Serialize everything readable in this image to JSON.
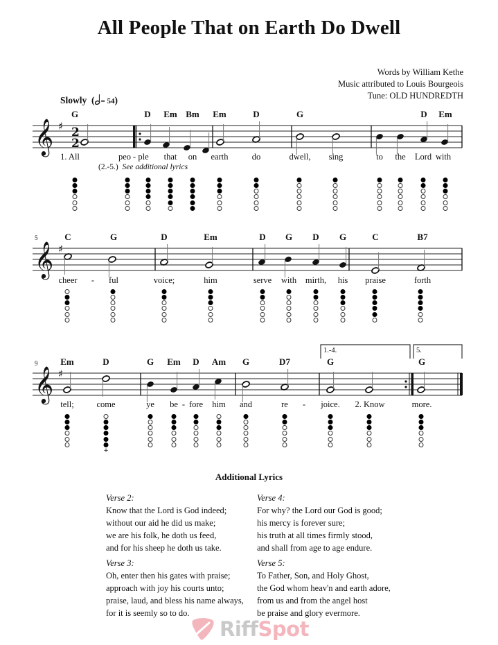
{
  "title": "All People That on Earth Do Dwell",
  "credits": [
    "Words by William Kethe",
    "Music attributed to Louis Bourgeois",
    "Tune: OLD HUNDREDTH"
  ],
  "tempo": {
    "label": "Slowly",
    "bpm_text": "= 54",
    "note": "half"
  },
  "key_signature": "G major (1 sharp)",
  "time_signature": "2/2",
  "systems": [
    {
      "measure_number": "",
      "chords": [
        "G",
        "D",
        "Em",
        "Bm",
        "Em",
        "D",
        "G",
        "D",
        "Em"
      ],
      "lyrics": [
        "1. All",
        "peo",
        "-",
        "ple",
        "that",
        "on",
        "earth",
        "do",
        "dwell,",
        "sing",
        "to",
        "the",
        "Lord",
        "with"
      ],
      "alt_lyric": {
        "prefix": "(2.-5.)",
        "text": "See additional lyrics"
      },
      "fingerings": [
        "CCCOOO",
        "CCCOOO",
        "CCCCOO",
        "CCCCCO",
        "CCCCCC",
        "CCCOOO",
        "CCOOOO",
        "COOOOO",
        "COOOOO",
        "COOOOO",
        "COOOOO",
        "CCOOOO",
        "CCCOOO"
      ]
    },
    {
      "measure_number": "5",
      "chords": [
        "C",
        "G",
        "D",
        "Em",
        "D",
        "G",
        "D",
        "G",
        "C",
        "B7"
      ],
      "lyrics": [
        "cheer",
        "-",
        "ful",
        "voice;",
        "him",
        "serve",
        "with",
        "mirth,",
        "his",
        "praise",
        "forth"
      ],
      "fingerings": [
        "OCCOOO",
        "COOOOO",
        "CCOOOO",
        "CCCOOO",
        "CCOOOO",
        "COOOOO",
        "CCOOOO",
        "CCCOOO",
        "CCCCCO",
        "CCCCOO"
      ]
    },
    {
      "measure_number": "9",
      "chords": [
        "Em",
        "D",
        "G",
        "Em",
        "D",
        "Am",
        "G",
        "D7",
        "G",
        "G"
      ],
      "endings": [
        "1.-4.",
        "5."
      ],
      "lyrics": [
        "tell;",
        "come",
        "ye",
        "be",
        "-",
        "fore",
        "him",
        "and",
        "re",
        "-",
        "joice.",
        "2. Know",
        "more."
      ],
      "fingerings": [
        "CCCOOO",
        "OCCCCC+",
        "COOOOO",
        "CCCOOO",
        "CCOOOO",
        "OCCOOO",
        "COOOOO",
        "CCOOOO",
        "CCCOOO",
        "CCCOOO",
        "CCCOOO"
      ]
    }
  ],
  "additional_lyrics": {
    "title": "Additional Lyrics",
    "verses": [
      {
        "label": "Verse 2:",
        "lines": [
          "Know that the Lord is God indeed;",
          "without our aid he did us make;",
          "we are his folk, he doth us feed,",
          "and for his sheep he doth us take."
        ]
      },
      {
        "label": "Verse 4:",
        "lines": [
          "For why? the Lord our God is good;",
          "his mercy is forever sure;",
          "his truth at all times firmly stood,",
          "and shall from age to age endure."
        ]
      },
      {
        "label": "Verse 3:",
        "lines": [
          "Oh, enter then his gates with praise;",
          "approach with joy his courts unto;",
          "praise, laud, and bless his name always,",
          "for it is seemly so to do."
        ]
      },
      {
        "label": "Verse 5:",
        "lines": [
          "To Father, Son, and Holy Ghost,",
          "the God whom heav'n and earth adore,",
          "from us and from the angel host",
          "be praise and glory evermore."
        ]
      }
    ]
  },
  "watermark": {
    "brand_part1": "Riff",
    "brand_part2": "Spot",
    "colors": {
      "pick": "#f4b6bd",
      "riff": "#c9c9c9",
      "spot": "#f4b6bd"
    }
  }
}
